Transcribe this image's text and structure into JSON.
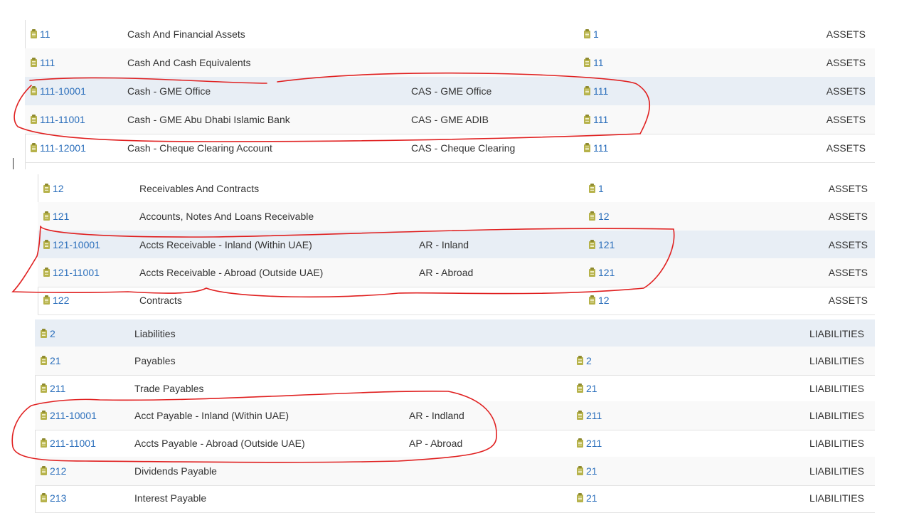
{
  "colors": {
    "link": "#2a6ebb",
    "icon": "#b6b24a",
    "annotation": "#e02020",
    "row_highlight": "#e8eef5",
    "row_alt": "#f9f9f9"
  },
  "icons": {
    "row_icon": "clipboard-icon"
  },
  "sections": [
    {
      "rows": [
        {
          "code": "11",
          "name": "Cash And Financial Assets",
          "short": "",
          "parent": "1",
          "type": "ASSETS"
        },
        {
          "code": "111",
          "name": "Cash And Cash Equivalents",
          "short": "",
          "parent": "11",
          "type": "ASSETS"
        },
        {
          "code": "111-10001",
          "name": "Cash - GME Office",
          "short": "CAS - GME Office",
          "parent": "111",
          "type": "ASSETS"
        },
        {
          "code": "111-11001",
          "name": "Cash - GME Abu Dhabi Islamic Bank",
          "short": "CAS - GME ADIB",
          "parent": "111",
          "type": "ASSETS"
        },
        {
          "code": "111-12001",
          "name": "Cash - Cheque Clearing Account",
          "short": "CAS - Cheque Clearing",
          "parent": "111",
          "type": "ASSETS"
        }
      ]
    },
    {
      "rows": [
        {
          "code": "12",
          "name": "Receivables And Contracts",
          "short": "",
          "parent": "1",
          "type": "ASSETS"
        },
        {
          "code": "121",
          "name": "Accounts, Notes And Loans Receivable",
          "short": "",
          "parent": "12",
          "type": "ASSETS"
        },
        {
          "code": "121-10001",
          "name": "Accts Receivable - Inland (Within UAE)",
          "short": "AR - Inland",
          "parent": "121",
          "type": "ASSETS"
        },
        {
          "code": "121-11001",
          "name": "Accts Receivable - Abroad (Outside UAE)",
          "short": "AR - Abroad",
          "parent": "121",
          "type": "ASSETS"
        },
        {
          "code": "122",
          "name": "Contracts",
          "short": "",
          "parent": "12",
          "type": "ASSETS"
        }
      ]
    },
    {
      "rows": [
        {
          "code": "2",
          "name": "Liabilities",
          "short": "",
          "parent": "",
          "type": "LIABILITIES"
        },
        {
          "code": "21",
          "name": "Payables",
          "short": "",
          "parent": "2",
          "type": "LIABILITIES"
        },
        {
          "code": "211",
          "name": "Trade Payables",
          "short": "",
          "parent": "21",
          "type": "LIABILITIES"
        },
        {
          "code": "211-10001",
          "name": "Acct Payable - Inland (Within UAE)",
          "short": "AR - Indland",
          "parent": "211",
          "type": "LIABILITIES"
        },
        {
          "code": "211-11001",
          "name": "Accts Payable - Abroad (Outside UAE)",
          "short": "AP - Abroad",
          "parent": "211",
          "type": "LIABILITIES"
        },
        {
          "code": "212",
          "name": "Dividends Payable",
          "short": "",
          "parent": "21",
          "type": "LIABILITIES"
        },
        {
          "code": "213",
          "name": "Interest Payable",
          "short": "",
          "parent": "21",
          "type": "LIABILITIES"
        }
      ]
    }
  ]
}
